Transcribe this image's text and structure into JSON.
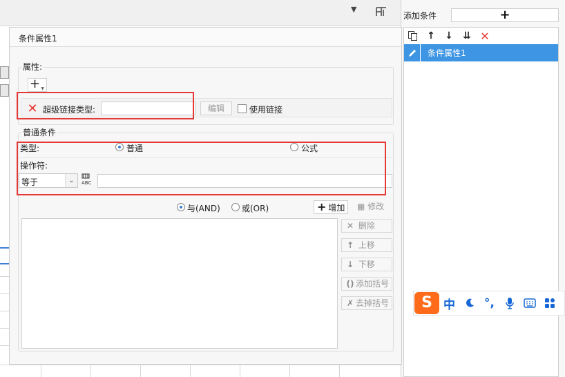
{
  "sidebar": {
    "title": "添加条件",
    "add_symbol": "+",
    "items": [
      {
        "label": "条件属性1",
        "selected": true
      }
    ],
    "toolbar_icons": [
      "copy-icon",
      "move-up-icon",
      "move-down-icon",
      "move-bottom-icon",
      "delete-icon"
    ]
  },
  "dialog": {
    "title": "条件属性1",
    "properties": {
      "legend": "属性:",
      "add_symbol": "+",
      "hyperlink": {
        "label": "超级链接类型:",
        "value": "",
        "edit_label": "编辑",
        "use_link_label": "使用链接",
        "use_link_checked": false
      }
    },
    "normal_condition": {
      "legend": "普通条件",
      "type_label": "类型:",
      "type_options": [
        {
          "label": "普通",
          "checked": true
        },
        {
          "label": "公式",
          "checked": false
        }
      ],
      "operator_label": "操作符:",
      "operator_value": "等于",
      "abc_icon_text": "ABC",
      "value": ""
    },
    "logic": {
      "and_label": "与(AND)",
      "and_checked": true,
      "or_label": "或(OR)",
      "or_checked": false
    },
    "buttons": {
      "add": "增加",
      "modify": "修改",
      "delete": "删除",
      "move_up": "上移",
      "move_down": "下移",
      "add_bracket": "添加括号",
      "remove_bracket": "去掉括号"
    }
  },
  "ime": {
    "logo": "S",
    "mode": "中",
    "punct": "°,"
  },
  "colors": {
    "selected_item": "#3e95e3",
    "highlight_box": "#e53935",
    "ime_logo": "#ff6b1a",
    "ime_icons": "#1768d6"
  }
}
